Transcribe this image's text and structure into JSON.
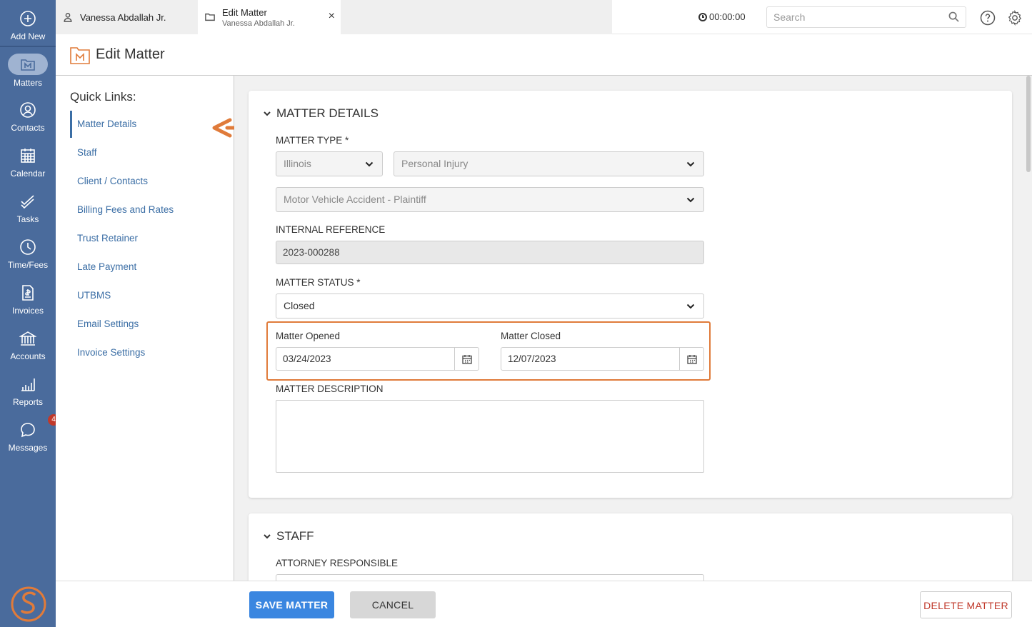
{
  "rail": {
    "items": [
      {
        "label": "Add New",
        "icon": "plus-circle-icon"
      },
      {
        "label": "Matters",
        "icon": "matters-icon"
      },
      {
        "label": "Contacts",
        "icon": "contacts-icon"
      },
      {
        "label": "Calendar",
        "icon": "calendar-icon"
      },
      {
        "label": "Tasks",
        "icon": "tasks-icon"
      },
      {
        "label": "Time/Fees",
        "icon": "clock-icon"
      },
      {
        "label": "Invoices",
        "icon": "invoice-icon"
      },
      {
        "label": "Accounts",
        "icon": "bank-icon"
      },
      {
        "label": "Reports",
        "icon": "bar-chart-icon"
      },
      {
        "label": "Messages",
        "icon": "chat-icon",
        "badge": "4"
      }
    ]
  },
  "topbar": {
    "tab1": {
      "title": "Vanessa Abdallah Jr."
    },
    "tab2": {
      "title": "Edit Matter",
      "subtitle": "Vanessa Abdallah Jr.",
      "close": "×"
    },
    "timer": "00:00:00",
    "search_placeholder": "Search"
  },
  "page": {
    "title": "Edit Matter"
  },
  "quick_links": {
    "title": "Quick Links:",
    "items": [
      "Matter Details",
      "Staff",
      "Client / Contacts",
      "Billing Fees and Rates",
      "Trust Retainer",
      "Late Payment",
      "UTBMS",
      "Email Settings",
      "Invoice Settings"
    ]
  },
  "matter_details": {
    "heading": "MATTER DETAILS",
    "matter_type_label": "MATTER TYPE *",
    "state": "Illinois",
    "practice_area": "Personal Injury",
    "subtype": "Motor Vehicle Accident - Plaintiff",
    "internal_reference_label": "INTERNAL REFERENCE",
    "internal_reference": "2023-000288",
    "matter_status_label": "MATTER STATUS *",
    "matter_status": "Closed",
    "opened_label": "Matter Opened",
    "opened_date": "03/24/2023",
    "closed_label": "Matter Closed",
    "closed_date": "12/07/2023",
    "description_label": "MATTER DESCRIPTION"
  },
  "staff": {
    "heading": "STAFF",
    "attorney_label": "ATTORNEY RESPONSIBLE"
  },
  "footer": {
    "save": "SAVE MATTER",
    "cancel": "CANCEL",
    "delete": "DELETE MATTER"
  },
  "colors": {
    "rail": "#4a6b9c",
    "accent": "#e07b3a",
    "link": "#3b6ea5",
    "save": "#3a86e0",
    "delete": "#c0392b"
  }
}
